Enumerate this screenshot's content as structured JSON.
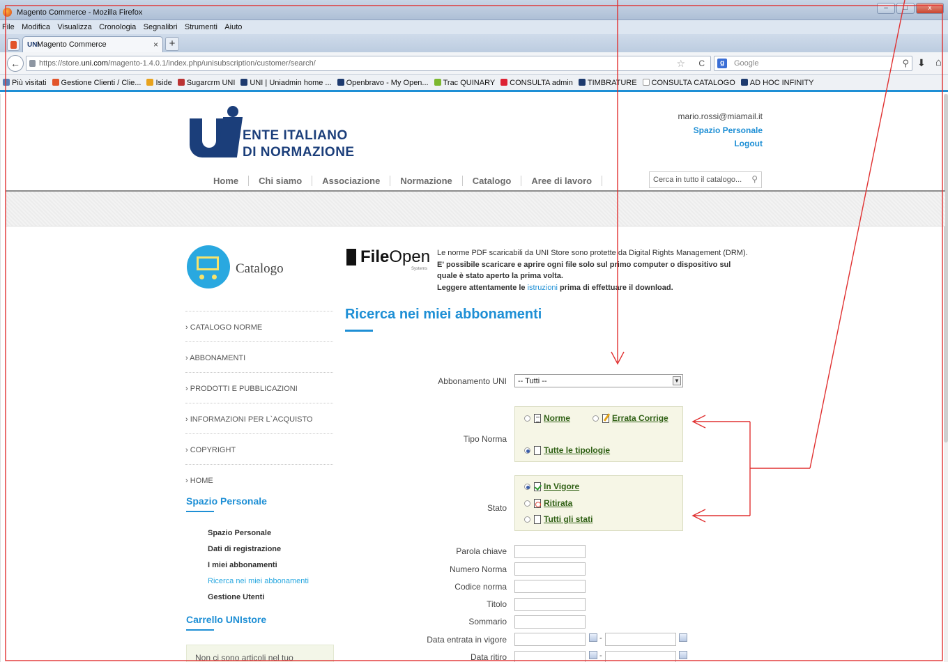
{
  "browser": {
    "window_title": "Magento Commerce - Mozilla Firefox",
    "menu": [
      "File",
      "Modifica",
      "Visualizza",
      "Cronologia",
      "Segnalibri",
      "Strumenti",
      "Aiuto"
    ],
    "tab_label": "Magento Commerce",
    "tab_close": "×",
    "new_tab": "+",
    "url_prefix": "https://store.",
    "url_domain": "uni.com",
    "url_rest": "/magento-1.4.0.1/index.php/unisubscription/customer/search/",
    "search_engine": "Google",
    "bookmarks": [
      "Più visitati",
      "Gestione Clienti / Clie...",
      "Iside",
      "Sugarcrm UNI",
      "UNI | Uniadmin home ...",
      "Openbravo - My Open...",
      "Trac QUINARY",
      "CONSULTA admin",
      "TIMBRATURE",
      "CONSULTA CATALOGO",
      "AD HOC INFINITY"
    ],
    "bookmark_colors": [
      "#5a7fb5",
      "#e2542a",
      "#e8a21c",
      "#b33",
      "#1d3a6e",
      "#1d3a6e",
      "#7cb82f",
      "#d23",
      "#1d3a6e",
      "#ffffff",
      "#1d3a6e",
      "#3a9a3a"
    ]
  },
  "site": {
    "logo_line1": "ENTE ITALIANO",
    "logo_line2": "DI NORMAZIONE",
    "user_email": "mario.rossi@miamail.it",
    "spazio_personale": "Spazio Personale",
    "logout": "Logout",
    "nav": [
      "Home",
      "Chi siamo",
      "Associazione",
      "Normazione",
      "Catalogo",
      "Aree di lavoro"
    ],
    "search_placeholder": "Cerca in tutto il catalogo..."
  },
  "sidebar": {
    "catalog_title": "Catalogo",
    "menu": [
      "CATALOGO NORME",
      "ABBONAMENTI",
      "PRODOTTI E PUBBLICAZIONI",
      "INFORMAZIONI PER L`ACQUISTO",
      "COPYRIGHT",
      "HOME"
    ],
    "spazio_title": "Spazio Personale",
    "sublinks": [
      "Spazio Personale",
      "Dati di registrazione",
      "I miei abbonamenti",
      "Ricerca nei miei abbonamenti",
      "Gestione Utenti"
    ],
    "active_sublink": "Ricerca nei miei abbonamenti",
    "cart_title": "Carrello UNIstore",
    "cart_empty": "Non ci sono articoli nel tuo carrello."
  },
  "drm": {
    "brand_bold": "File",
    "brand_rest": "Open",
    "brand_sub": "Systems",
    "line1": "Le norme PDF scaricabili da UNI Store sono protette da Digital Rights Management (DRM).",
    "line2": "E' possibile scaricare e aprire ogni file solo sul primo computer o dispositivo sul quale è stato aperto la prima volta.",
    "line3_a": "Leggere attentamente le ",
    "line3_link": "istruzioni",
    "line3_b": " prima di effettuare il download."
  },
  "form": {
    "page_title": "Ricerca nei miei abbonamenti",
    "abbonamento_label": "Abbonamento UNI",
    "abbonamento_value": "-- Tutti --",
    "tipo_norma_label": "Tipo Norma",
    "tipo_options": [
      "Norme",
      "Errata Corrige",
      "Tutte le tipologie"
    ],
    "tipo_selected": "Tutte le tipologie",
    "stato_label": "Stato",
    "stato_options": [
      "In Vigore",
      "Ritirata",
      "Tutti gli stati"
    ],
    "stato_selected": "In Vigore",
    "text_fields": [
      "Parola chiave",
      "Numero Norma",
      "Codice norma",
      "Titolo",
      "Sommario"
    ],
    "date_fields": [
      "Data entrata in vigore",
      "Data ritiro"
    ],
    "date_separator": "-"
  },
  "colors": {
    "accent_blue": "#1e8fd5",
    "brand_navy": "#1b3e7a",
    "radio_link_green": "#2e5f13",
    "annotation_red": "#e03030"
  }
}
